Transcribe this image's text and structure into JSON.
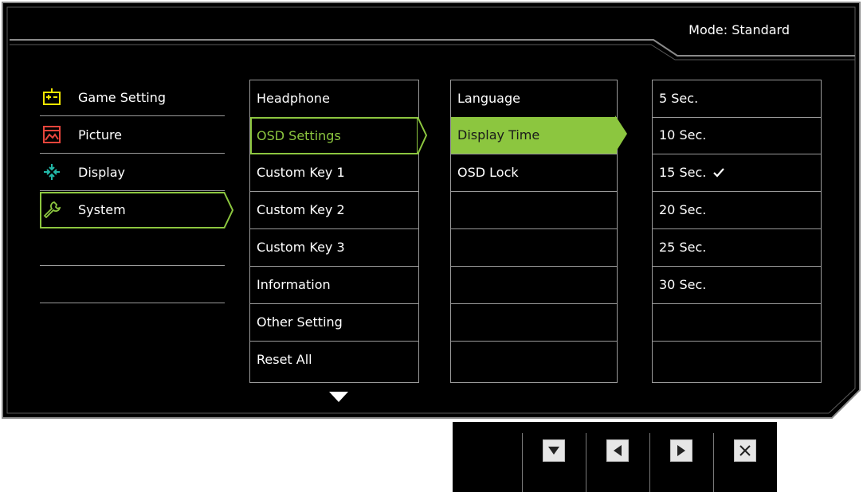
{
  "header": {
    "mode_label": "Mode: Standard"
  },
  "main_menu": [
    {
      "label": "Game Setting",
      "icon": "game-setting-icon",
      "selected": false
    },
    {
      "label": "Picture",
      "icon": "picture-icon",
      "selected": false
    },
    {
      "label": "Display",
      "icon": "display-icon",
      "selected": false
    },
    {
      "label": "System",
      "icon": "wrench-icon",
      "selected": true
    },
    {
      "label": "",
      "selected": false
    },
    {
      "label": "",
      "selected": false
    }
  ],
  "system_menu": [
    {
      "label": "Headphone"
    },
    {
      "label": "OSD Settings",
      "selected": true
    },
    {
      "label": "Custom Key 1"
    },
    {
      "label": "Custom Key 2"
    },
    {
      "label": "Custom Key 3"
    },
    {
      "label": "Information"
    },
    {
      "label": "Other Setting"
    },
    {
      "label": "Reset All"
    }
  ],
  "osd_menu": [
    {
      "label": "Language"
    },
    {
      "label": "Display Time",
      "selected": true
    },
    {
      "label": "OSD Lock"
    },
    {
      "label": ""
    },
    {
      "label": ""
    },
    {
      "label": ""
    },
    {
      "label": ""
    },
    {
      "label": ""
    }
  ],
  "display_time_options": [
    {
      "label": "5 Sec."
    },
    {
      "label": "10 Sec."
    },
    {
      "label": "15 Sec.",
      "checked": true
    },
    {
      "label": "20 Sec."
    },
    {
      "label": "25 Sec."
    },
    {
      "label": "30 Sec."
    },
    {
      "label": ""
    },
    {
      "label": ""
    }
  ],
  "controls": [
    {
      "icon": "arrow-down-icon"
    },
    {
      "icon": "arrow-left-icon"
    },
    {
      "icon": "arrow-right-icon"
    },
    {
      "icon": "close-icon"
    }
  ],
  "colors": {
    "accent": "#8cc63f",
    "background": "#000000",
    "divider": "#9a9a9a"
  }
}
